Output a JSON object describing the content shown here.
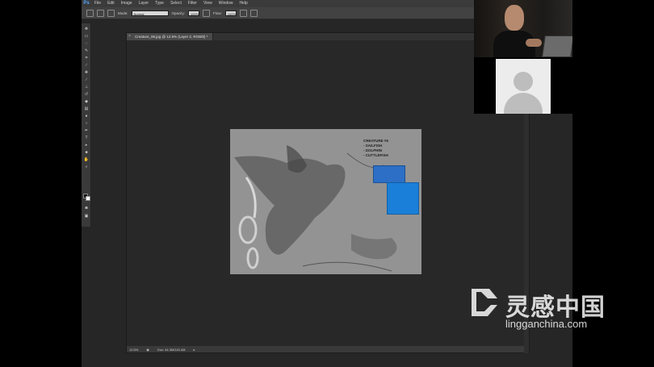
{
  "app": {
    "logo": "Ps",
    "menu": [
      "File",
      "Edit",
      "Image",
      "Layer",
      "Type",
      "Select",
      "Filter",
      "View",
      "Window",
      "Help"
    ]
  },
  "options_bar": {
    "mode_label": "Mode:",
    "mode_value": "Normal",
    "opacity_label": "Opacity:",
    "opacity_value": "100%",
    "flow_label": "Flow:",
    "flow_value": "100%"
  },
  "document": {
    "tab_title": "Creature_06.jpg @ 12.5% (Layer 2, RGB/8) *",
    "zoom": "12.5%",
    "doc_size": "Doc: 34.3M/115.4M",
    "artboard_notes": [
      "CREATURE #6",
      "- SAILFISH",
      "- DOLPHIN",
      "- CUTTLEFISH"
    ]
  },
  "colors": {
    "app_bg": "#262626",
    "menubar": "#3b3b3b",
    "options_bar": "#424242",
    "artboard": "#939393",
    "ps_accent": "#4fa7ff"
  },
  "tools": [
    "move-icon",
    "marquee-icon",
    "lasso-icon",
    "quick-select-icon",
    "crop-icon",
    "eyedropper-icon",
    "healing-icon",
    "brush-icon",
    "stamp-icon",
    "history-brush-icon",
    "eraser-icon",
    "gradient-icon",
    "blur-icon",
    "dodge-icon",
    "pen-icon",
    "type-icon",
    "path-select-icon",
    "shape-icon",
    "hand-icon",
    "zoom-icon"
  ],
  "watermark": {
    "cn": "灵感中国",
    "en": "lingganchina.com"
  }
}
